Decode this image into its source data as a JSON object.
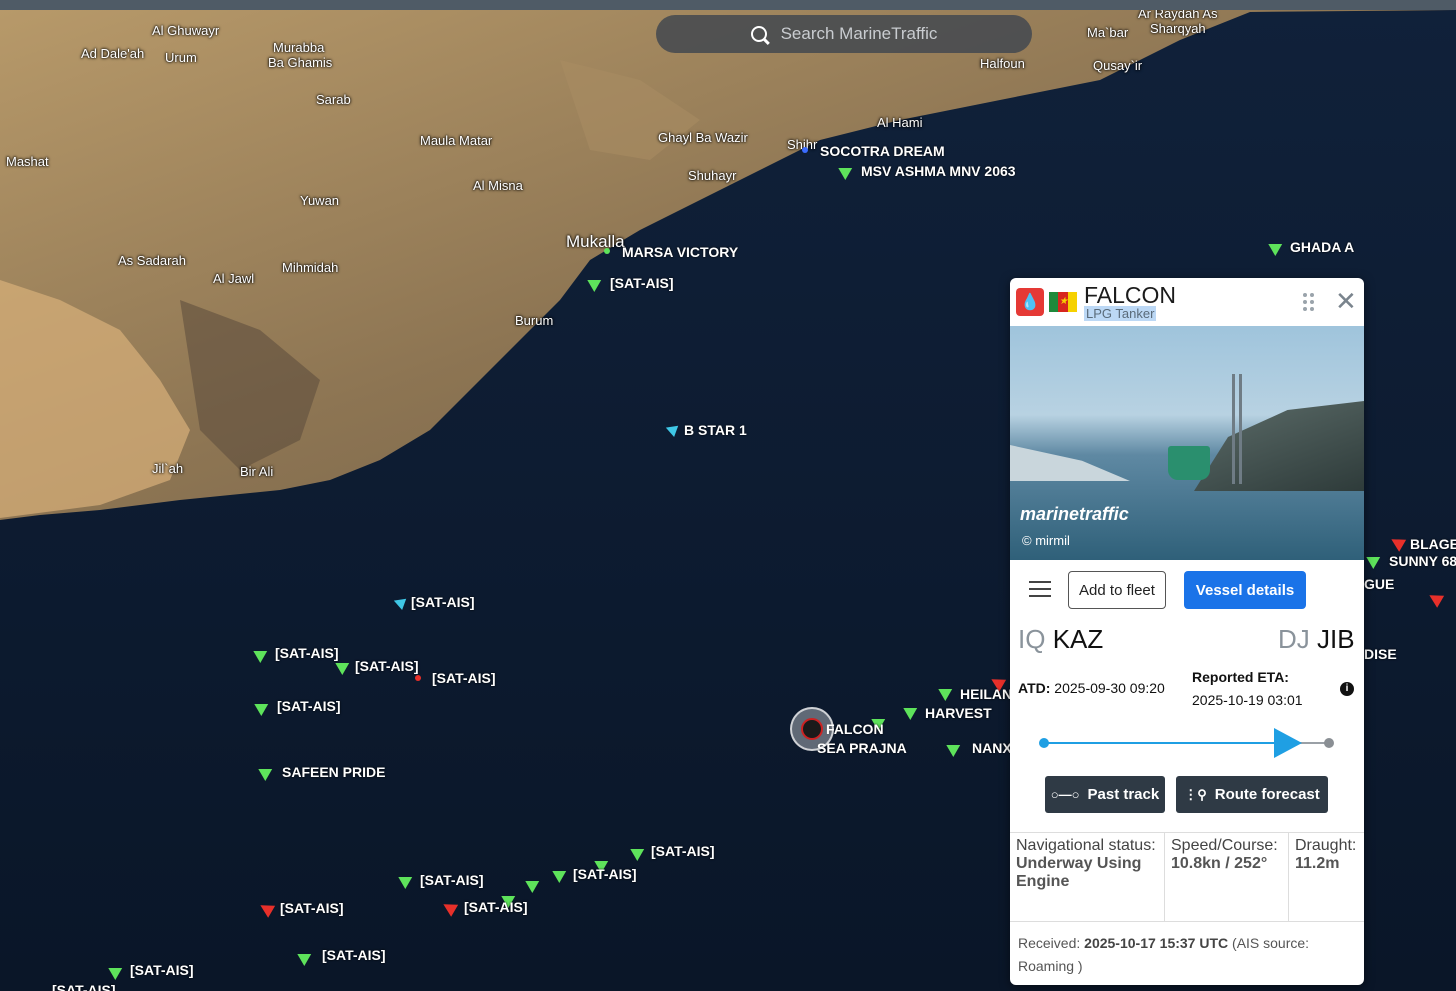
{
  "search": {
    "placeholder": "Search MarineTraffic"
  },
  "places": [
    {
      "name": "Al Ghuwayr"
    },
    {
      "name": "Ad Dale'ah"
    },
    {
      "name": "Urum"
    },
    {
      "name": "Murabba"
    },
    {
      "name": "Ba Ghamis"
    },
    {
      "name": "Sarab"
    },
    {
      "name": "Mashat"
    },
    {
      "name": "Maula Matar"
    },
    {
      "name": "Ghayl Ba Wazir"
    },
    {
      "name": "Al Misna"
    },
    {
      "name": "Shuhayr"
    },
    {
      "name": "Yuwan"
    },
    {
      "name": "Mukalla"
    },
    {
      "name": "As Sadarah"
    },
    {
      "name": "Mihmidah"
    },
    {
      "name": "Al Jawl"
    },
    {
      "name": "Burum"
    },
    {
      "name": "Jil`ah"
    },
    {
      "name": "Bir Ali"
    },
    {
      "name": "Shihr"
    },
    {
      "name": "Al Hami"
    },
    {
      "name": "Halfoun"
    },
    {
      "name": "Ma`bar"
    },
    {
      "name": "Ar Raydah As"
    },
    {
      "name": "Sharqyah"
    },
    {
      "name": "Qusay`ir"
    }
  ],
  "ships": [
    {
      "name": "SOCOTRA DREAM"
    },
    {
      "name": "MSV ASHMA MNV 2063"
    },
    {
      "name": "MARSA VICTORY"
    },
    {
      "name": "[SAT-AIS]"
    },
    {
      "name": "GHADA A"
    },
    {
      "name": "B STAR 1"
    },
    {
      "name": "[SAT-AIS]"
    },
    {
      "name": "[SAT-AIS]"
    },
    {
      "name": "[SAT-AIS]"
    },
    {
      "name": "[SAT-AIS]"
    },
    {
      "name": "[SAT-AIS]"
    },
    {
      "name": "SAFEEN PRIDE"
    },
    {
      "name": "FALCON"
    },
    {
      "name": "SEA PRAJNA"
    },
    {
      "name": "HEILAN"
    },
    {
      "name": "HARVEST"
    },
    {
      "name": "NANX"
    },
    {
      "name": "[SAT-AIS]"
    },
    {
      "name": "[SAT-AIS]"
    },
    {
      "name": "[SAT-AIS]"
    },
    {
      "name": "[SAT-AIS]"
    },
    {
      "name": "[SAT-AIS]"
    },
    {
      "name": "[SAT-AIS]"
    },
    {
      "name": "[SAT-AIS]"
    },
    {
      "name": "[SAT-AIS]"
    },
    {
      "name": "BLAGE"
    },
    {
      "name": "SUNNY 68"
    },
    {
      "name": "GUE"
    },
    {
      "name": "DISE"
    }
  ],
  "panel": {
    "vessel_name": "FALCON",
    "vessel_type": "LPG Tanker",
    "flag_colors": [
      "#1f8a3b",
      "#d7261e",
      "#f6d100"
    ],
    "photo_watermark": "marinetraffic",
    "photo_credit": "© mirmil",
    "add_fleet_label": "Add to fleet",
    "vessel_details_label": "Vessel details",
    "origin_cc": "IQ",
    "origin_port": "KAZ",
    "dest_cc": "DJ",
    "dest_port": "JIB",
    "atd_label": "ATD:",
    "atd_value": "2025-09-30 09:20",
    "eta_label": "Reported ETA:",
    "eta_value": "2025-10-19 03:01",
    "past_track_label": "Past track",
    "route_forecast_label": "Route forecast",
    "nav_status_label": "Navigational status:",
    "nav_status_value": "Underway Using Engine",
    "speed_label": "Speed/Course:",
    "speed_value": "10.8kn / 252°",
    "draught_label": "Draught:",
    "draught_value": "11.2m",
    "received_label": "Received:",
    "received_value": "2025-10-17 15:37 UTC",
    "received_source": "(AIS source: Roaming )"
  }
}
